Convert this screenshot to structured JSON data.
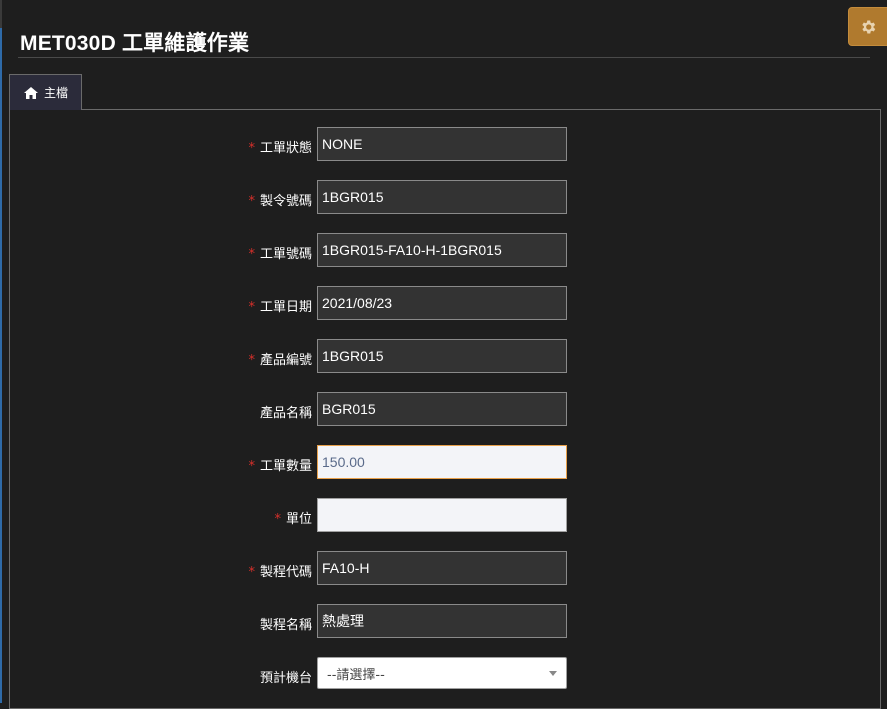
{
  "page": {
    "title": "MET030D 工單維護作業"
  },
  "tabs": [
    {
      "label": "主檔",
      "icon": "home-icon"
    }
  ],
  "form": {
    "required_marker": "*",
    "fields": [
      {
        "label": "工單狀態",
        "value": "NONE",
        "required": true
      },
      {
        "label": "製令號碼",
        "value": "1BGR015",
        "required": true
      },
      {
        "label": "工單號碼",
        "value": "1BGR015-FA10-H-1BGR015",
        "required": true
      },
      {
        "label": "工單日期",
        "value": "2021/08/23",
        "required": true
      },
      {
        "label": "產品編號",
        "value": "1BGR015",
        "required": true
      },
      {
        "label": "產品名稱",
        "value": "BGR015",
        "required": false
      },
      {
        "label": "工單數量",
        "value": "150.00",
        "required": true
      },
      {
        "label": "單位",
        "value": "",
        "required": true
      },
      {
        "label": "製程代碼",
        "value": "FA10-H",
        "required": true
      },
      {
        "label": "製程名稱",
        "value": "熱處理",
        "required": false
      },
      {
        "label": "預計機台",
        "value": "--請選擇--",
        "required": false
      }
    ]
  },
  "colors": {
    "accent_button": "#b07a2e",
    "required_star": "#d9302b",
    "focus_border": "#e8a04a"
  }
}
